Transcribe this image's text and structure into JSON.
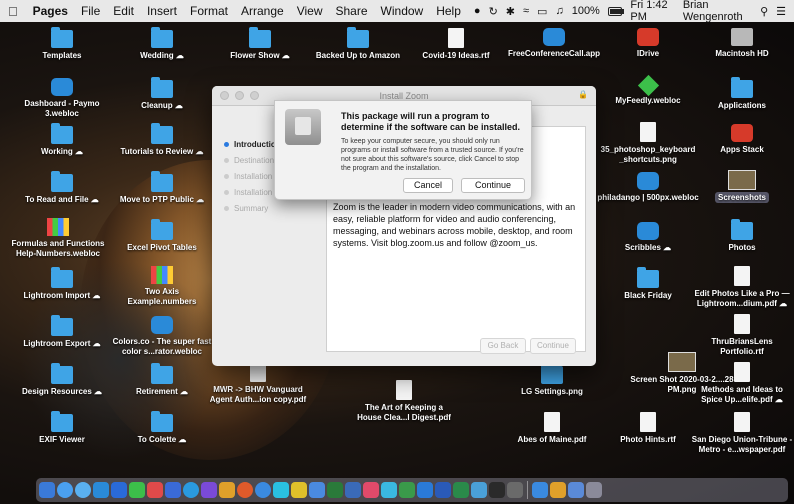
{
  "menubar": {
    "app": "Pages",
    "items": [
      "File",
      "Edit",
      "Insert",
      "Format",
      "Arrange",
      "View",
      "Share",
      "Window",
      "Help"
    ],
    "battery": "100%",
    "clock": "Fri 1:42 PM",
    "user": "Brian Wengenroth"
  },
  "desktop": {
    "icons": [
      {
        "label": "Templates",
        "kind": "folder"
      },
      {
        "label": "Wedding ☁",
        "kind": "folder"
      },
      {
        "label": "Flower Show ☁",
        "kind": "folder"
      },
      {
        "label": "Backed Up to Amazon",
        "kind": "folder"
      },
      {
        "label": "Covid-19 Ideas.rtf",
        "kind": "doc"
      },
      {
        "label": "FreeConferenceCall.app",
        "kind": "app"
      },
      {
        "label": "IDrive",
        "kind": "red"
      },
      {
        "label": "Macintosh HD",
        "kind": "disk"
      },
      {
        "label": "Dashboard - Paymo 3.webloc",
        "kind": "app"
      },
      {
        "label": "Cleanup ☁",
        "kind": "folder"
      },
      {
        "label": "MyFeedly.webloc",
        "kind": "green"
      },
      {
        "label": "Applications",
        "kind": "folder"
      },
      {
        "label": "Working ☁",
        "kind": "folder"
      },
      {
        "label": "Tutorials to Review ☁",
        "kind": "folder"
      },
      {
        "label": "35_photoshop_keyboard _shortcuts.png",
        "kind": "doc"
      },
      {
        "label": "Apps Stack",
        "kind": "red"
      },
      {
        "label": "To Read and File ☁",
        "kind": "folder"
      },
      {
        "label": "Move to PTP Public ☁",
        "kind": "folder"
      },
      {
        "label": "philadango | 500px.webloc",
        "kind": "app"
      },
      {
        "label": "Screenshots",
        "kind": "folder"
      },
      {
        "label": "Formulas and Functions Help-Numbers.webloc",
        "kind": "chart"
      },
      {
        "label": "Excel Pivot Tables",
        "kind": "folder"
      },
      {
        "label": "Scribbles ☁",
        "kind": "app"
      },
      {
        "label": "Photos",
        "kind": "folder"
      },
      {
        "label": "Lightroom Import ☁",
        "kind": "folder"
      },
      {
        "label": "Two Axis Example.numbers",
        "kind": "chart"
      },
      {
        "label": "Black Friday",
        "kind": "folder"
      },
      {
        "label": "Edit Photos Like a Pro — Lightroom...dium.pdf ☁",
        "kind": "doc"
      },
      {
        "label": "Lightroom Export ☁",
        "kind": "folder"
      },
      {
        "label": "Colors.co - The super fast color s...rator.webloc",
        "kind": "app"
      },
      {
        "label": "ThruBriansLens Portfolio.rtf",
        "kind": "doc"
      },
      {
        "label": "Design Resources ☁",
        "kind": "folder"
      },
      {
        "label": "Retirement ☁",
        "kind": "folder"
      },
      {
        "label": "MWR -> BHW Vanguard Agent Auth...ion copy.pdf",
        "kind": "doc"
      },
      {
        "label": "The Art of Keeping a House Clea...l Digest.pdf",
        "kind": "doc"
      },
      {
        "label": "LG Settings.png",
        "kind": "folder"
      },
      {
        "label": "Screen Shot 2020-03-2....28 PM.png",
        "kind": "img"
      },
      {
        "label": "Methods and Ideas to Spice Up...elife.pdf ☁",
        "kind": "doc"
      },
      {
        "label": "EXIF Viewer",
        "kind": "folder"
      },
      {
        "label": "To Colette ☁",
        "kind": "folder"
      },
      {
        "label": "Abes of Maine.pdf",
        "kind": "doc"
      },
      {
        "label": "Photo Hints.rtf",
        "kind": "doc"
      },
      {
        "label": "San Diego Union-Tribune - Metro - e...wspaper.pdf",
        "kind": "doc"
      }
    ]
  },
  "installer": {
    "title": "Install Zoom",
    "steps": [
      "Introduction",
      "Destination",
      "Installation",
      "Installation",
      "Summary"
    ],
    "description": "Zoom is the leader in modern video communications, with an easy, reliable platform for video and audio conferencing, messaging, and webinars across mobile, desktop, and room systems. Visit blog.zoom.us and follow @zoom_us.",
    "back_label": "Go Back",
    "continue_label": "Continue"
  },
  "sheet": {
    "heading": "This package will run a program to determine if the software can be installed.",
    "body": "To keep your computer secure, you should only run programs or install software from a trusted source. If you're not sure about this software's source, click Cancel to stop the program and the installation.",
    "cancel_label": "Cancel",
    "continue_label": "Continue"
  }
}
